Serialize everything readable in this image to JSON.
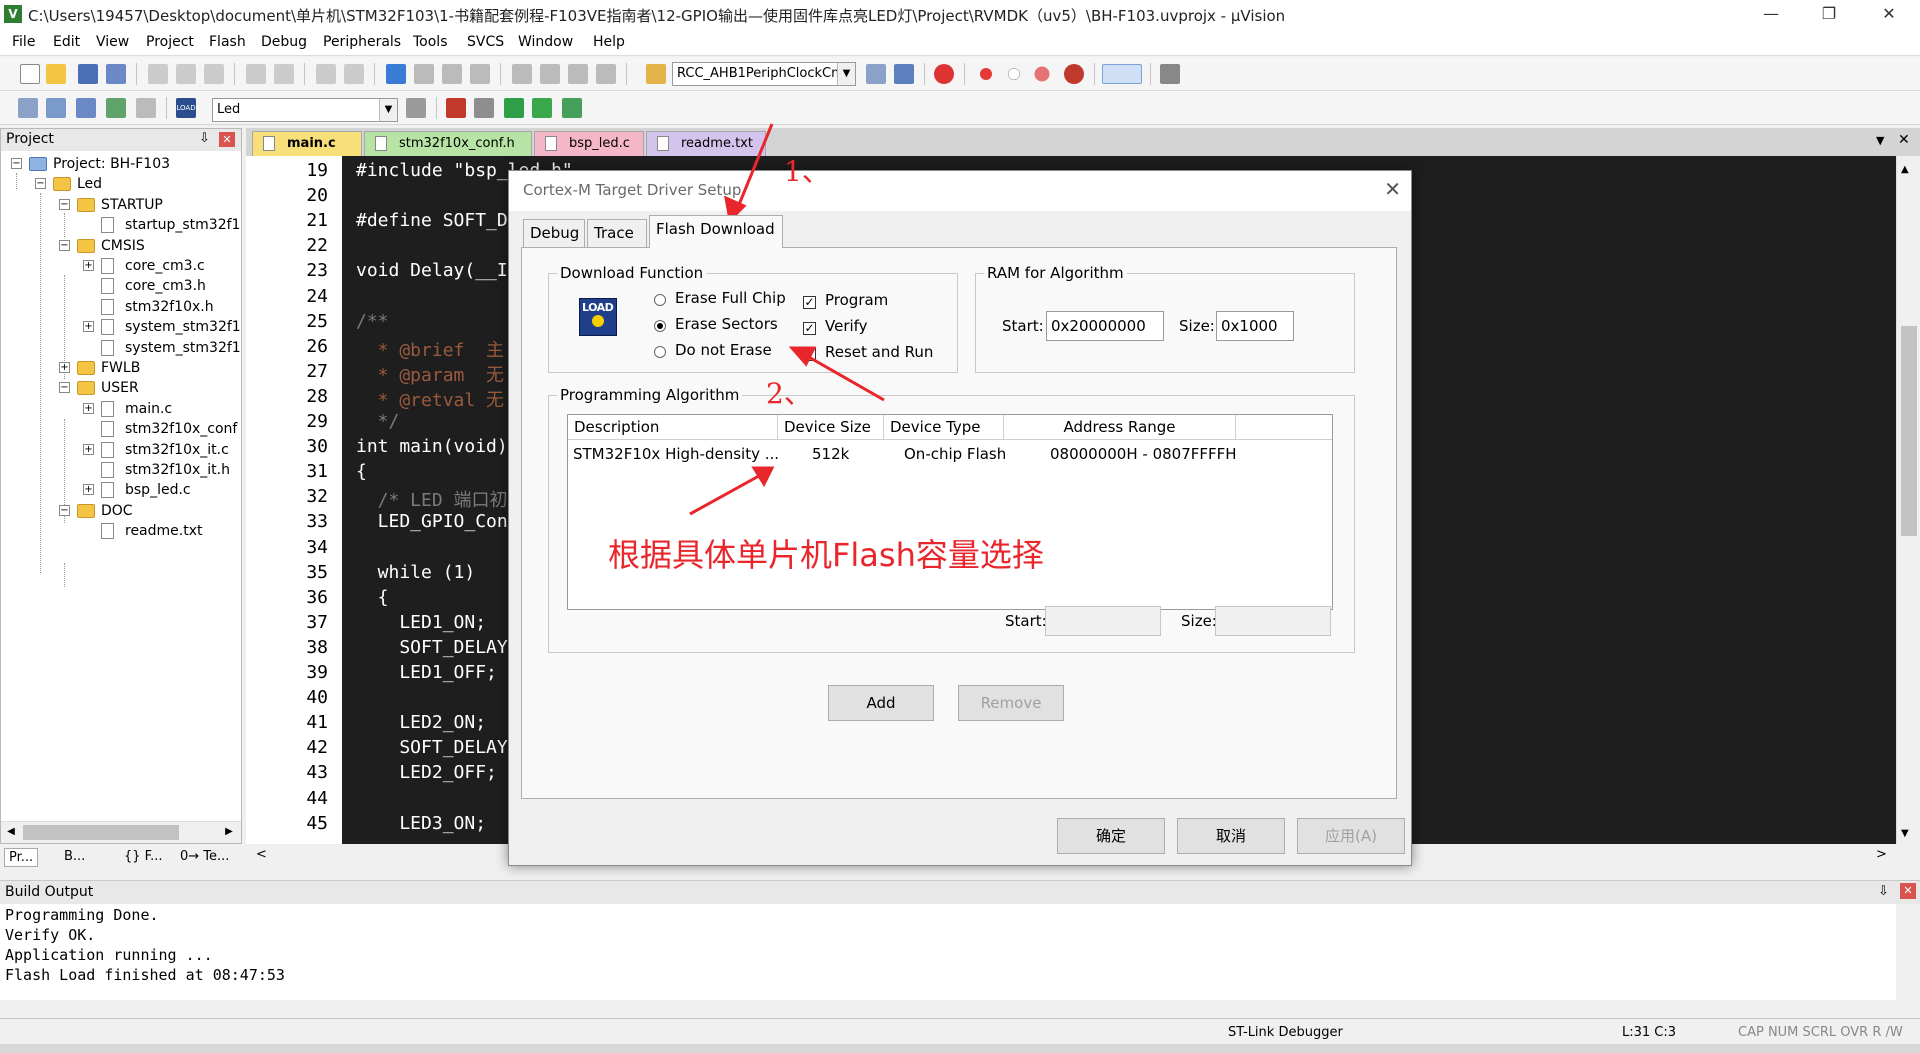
{
  "window": {
    "title": "C:\\Users\\19457\\Desktop\\document\\单片机\\STM32F103\\1-书籍配套例程-F103VE指南者\\12-GPIO输出—使用固件库点亮LED灯\\Project\\RVMDK（uv5）\\BH-F103.uvprojx - µVision",
    "minimize": "—",
    "restore": "❐",
    "close": "✕"
  },
  "menu": [
    "File",
    "Edit",
    "View",
    "Project",
    "Flash",
    "Debug",
    "Peripherals",
    "Tools",
    "SVCS",
    "Window",
    "Help"
  ],
  "toolbar": {
    "function_combo": "RCC_AHB1PeriphClockCm",
    "target_combo": "Led",
    "load_label": "LOAD"
  },
  "project_panel": {
    "header": "Project",
    "pin": "⇩",
    "close": "✕",
    "tree": [
      {
        "label": "Project: BH-F103",
        "level": 0,
        "type": "project",
        "exp": "−"
      },
      {
        "label": "Led",
        "level": 1,
        "type": "target",
        "exp": "−"
      },
      {
        "label": "STARTUP",
        "level": 2,
        "type": "folder",
        "exp": "−"
      },
      {
        "label": "startup_stm32f1",
        "level": 3,
        "type": "file",
        "exp": ""
      },
      {
        "label": "CMSIS",
        "level": 2,
        "type": "folder",
        "exp": "−"
      },
      {
        "label": "core_cm3.c",
        "level": 3,
        "type": "file",
        "exp": "+"
      },
      {
        "label": "core_cm3.h",
        "level": 3,
        "type": "file",
        "exp": ""
      },
      {
        "label": "stm32f10x.h",
        "level": 3,
        "type": "file",
        "exp": ""
      },
      {
        "label": "system_stm32f1",
        "level": 3,
        "type": "file",
        "exp": "+"
      },
      {
        "label": "system_stm32f1",
        "level": 3,
        "type": "file",
        "exp": ""
      },
      {
        "label": "FWLB",
        "level": 2,
        "type": "folder",
        "exp": "+"
      },
      {
        "label": "USER",
        "level": 2,
        "type": "folder",
        "exp": "−"
      },
      {
        "label": "main.c",
        "level": 3,
        "type": "file",
        "exp": "+"
      },
      {
        "label": "stm32f10x_conf",
        "level": 3,
        "type": "file",
        "exp": ""
      },
      {
        "label": "stm32f10x_it.c",
        "level": 3,
        "type": "file",
        "exp": "+"
      },
      {
        "label": "stm32f10x_it.h",
        "level": 3,
        "type": "file",
        "exp": ""
      },
      {
        "label": "bsp_led.c",
        "level": 3,
        "type": "file",
        "exp": "+"
      },
      {
        "label": "DOC",
        "level": 2,
        "type": "folder",
        "exp": "−"
      },
      {
        "label": "readme.txt",
        "level": 3,
        "type": "file",
        "exp": ""
      }
    ],
    "bottom_tabs": [
      "Pr...",
      "B...",
      "{} F...",
      "0→ Te..."
    ]
  },
  "editor_tabs": [
    {
      "label": "main.c",
      "color": "#f7e07a",
      "active": true
    },
    {
      "label": "stm32f10x_conf.h",
      "color": "#b7e4a4",
      "active": false
    },
    {
      "label": "bsp_led.c",
      "color": "#f5b6c8",
      "active": false
    },
    {
      "label": "readme.txt",
      "color": "#d2c4ec",
      "active": false
    }
  ],
  "editor": {
    "lines": [
      {
        "n": "19",
        "code": "#include \"bsp_led.h\"",
        "color": "#ffffff"
      },
      {
        "n": "20",
        "code": "",
        "color": "#ffffff"
      },
      {
        "n": "21",
        "code": "#define SOFT_D",
        "color": "#ffffff"
      },
      {
        "n": "22",
        "code": "",
        "color": "#ffffff"
      },
      {
        "n": "23",
        "code": "void Delay(__I",
        "color": "#ffffff"
      },
      {
        "n": "24",
        "code": "",
        "color": "#ffffff"
      },
      {
        "n": "25",
        "code": "/**",
        "color": "#7a7a7a"
      },
      {
        "n": "26",
        "code": "  * @brief  主",
        "color": "#9a5a3e"
      },
      {
        "n": "27",
        "code": "  * @param  无",
        "color": "#9a5a3e"
      },
      {
        "n": "28",
        "code": "  * @retval 无",
        "color": "#9a5a3e"
      },
      {
        "n": "29",
        "code": "  */",
        "color": "#7a7a7a"
      },
      {
        "n": "30",
        "code": "int main(void)",
        "color": "#ffffff"
      },
      {
        "n": "31",
        "code": "{",
        "color": "#ffffff"
      },
      {
        "n": "32",
        "code": "  /* LED 端口初",
        "color": "#7a7a7a"
      },
      {
        "n": "33",
        "code": "  LED_GPIO_Con",
        "color": "#ffffff"
      },
      {
        "n": "34",
        "code": "",
        "color": "#ffffff"
      },
      {
        "n": "35",
        "code": "  while (1)",
        "color": "#ffffff"
      },
      {
        "n": "36",
        "code": "  {",
        "color": "#ffffff"
      },
      {
        "n": "37",
        "code": "    LED1_ON;",
        "color": "#ffffff"
      },
      {
        "n": "38",
        "code": "    SOFT_DELAY",
        "color": "#ffffff"
      },
      {
        "n": "39",
        "code": "    LED1_OFF;",
        "color": "#ffffff"
      },
      {
        "n": "40",
        "code": "",
        "color": "#ffffff"
      },
      {
        "n": "41",
        "code": "    LED2_ON;",
        "color": "#ffffff"
      },
      {
        "n": "42",
        "code": "    SOFT_DELAY",
        "color": "#ffffff"
      },
      {
        "n": "43",
        "code": "    LED2_OFF;",
        "color": "#ffffff"
      },
      {
        "n": "44",
        "code": "",
        "color": "#ffffff"
      },
      {
        "n": "45",
        "code": "    LED3_ON;",
        "color": "#ffffff"
      }
    ]
  },
  "build_output": {
    "header": "Build Output",
    "lines": [
      "Programming Done.",
      "Verify OK.",
      "Application running ...",
      "Flash Load finished at 08:47:53"
    ]
  },
  "statusbar": {
    "debugger": "ST-Link Debugger",
    "position": "L:31 C:3",
    "flags": "CAP  NUM  SCRL  OVR  R /W"
  },
  "dialog": {
    "title": "Cortex-M Target Driver Setup",
    "close": "✕",
    "tabs": [
      "Debug",
      "Trace",
      "Flash Download"
    ],
    "download_function": {
      "label": "Download Function",
      "icon_text": "LOAD",
      "radios": [
        {
          "label": "Erase Full Chip",
          "checked": false
        },
        {
          "label": "Erase Sectors",
          "checked": true
        },
        {
          "label": "Do not Erase",
          "checked": false
        }
      ],
      "checks": [
        {
          "label": "Program",
          "checked": true
        },
        {
          "label": "Verify",
          "checked": true
        },
        {
          "label": "Reset and Run",
          "checked": true
        }
      ]
    },
    "ram": {
      "label": "RAM for Algorithm",
      "start_label": "Start:",
      "start": "0x20000000",
      "size_label": "Size:",
      "size": "0x1000"
    },
    "algorithm": {
      "label": "Programming Algorithm",
      "columns": [
        "Description",
        "Device Size",
        "Device Type",
        "Address Range"
      ],
      "rows": [
        {
          "description": "STM32F10x High-density ...",
          "size": "512k",
          "type": "On-chip Flash",
          "range": "08000000H - 0807FFFFH"
        }
      ],
      "start_label": "Start:",
      "size_label": "Size:",
      "start": "",
      "size": ""
    },
    "buttons": {
      "add": "Add",
      "remove": "Remove",
      "ok": "确定",
      "cancel": "取消",
      "apply": "应用(A)"
    }
  },
  "annotations": {
    "note": "根据具体单片机Flash容量选择",
    "mark1": "1、",
    "mark2": "2、",
    "color": "#e8262b"
  }
}
